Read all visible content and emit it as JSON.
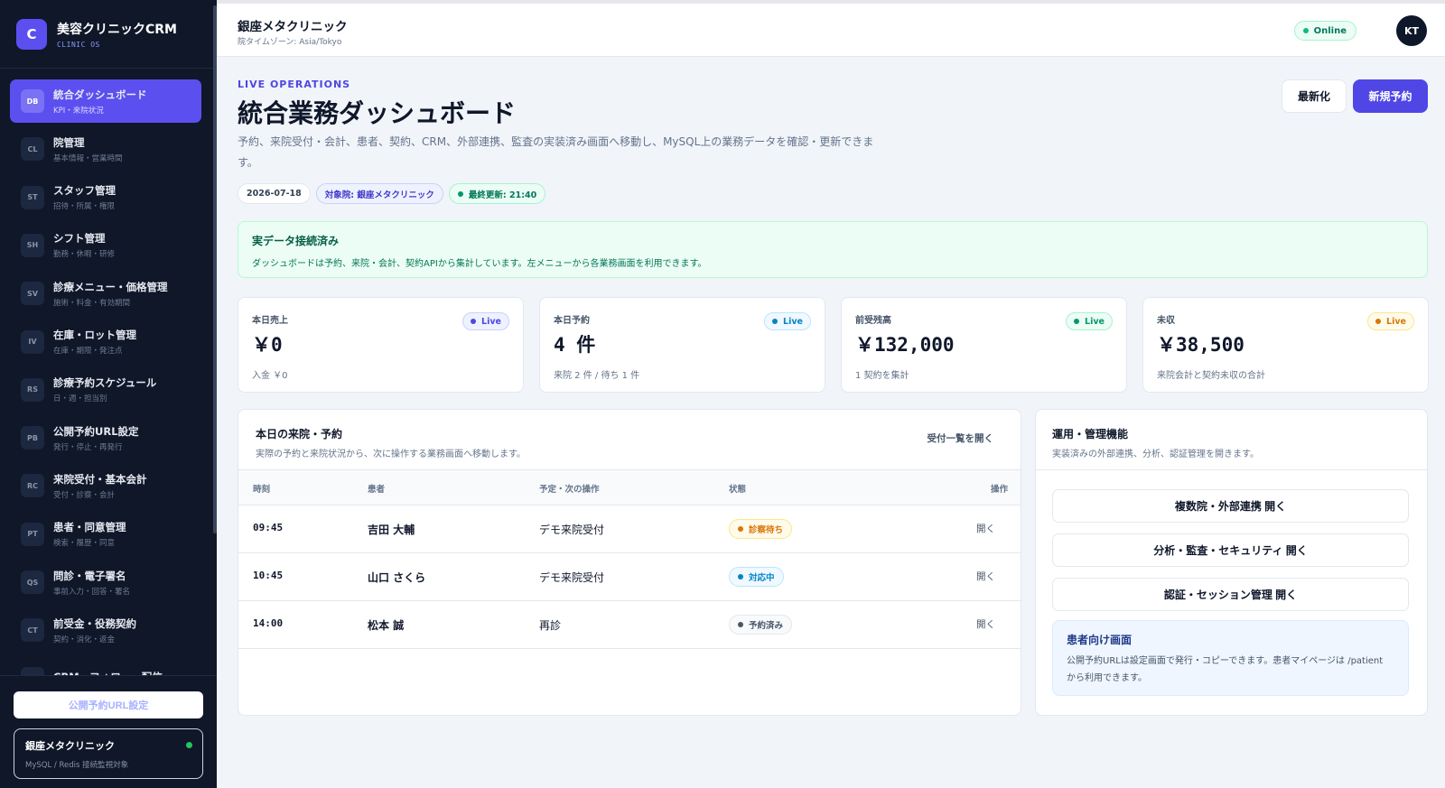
{
  "brand": {
    "logo": "C",
    "title": "美容クリニックCRM",
    "subtitle": "CLINIC OS"
  },
  "sidebar": {
    "items": [
      {
        "code": "DB",
        "label": "統合ダッシュボード",
        "sub": "KPI・来院状況",
        "active": true
      },
      {
        "code": "CL",
        "label": "院管理",
        "sub": "基本情報・営業時間"
      },
      {
        "code": "ST",
        "label": "スタッフ管理",
        "sub": "招待・所属・権限"
      },
      {
        "code": "SH",
        "label": "シフト管理",
        "sub": "勤務・休暇・研修"
      },
      {
        "code": "SV",
        "label": "診療メニュー・価格管理",
        "sub": "施術・料金・有効期間"
      },
      {
        "code": "IV",
        "label": "在庫・ロット管理",
        "sub": "在庫・期限・発注点"
      },
      {
        "code": "RS",
        "label": "診療予約スケジュール",
        "sub": "日・週・担当別"
      },
      {
        "code": "PB",
        "label": "公開予約URL設定",
        "sub": "発行・停止・再発行"
      },
      {
        "code": "RC",
        "label": "来院受付・基本会計",
        "sub": "受付・診察・会計"
      },
      {
        "code": "PT",
        "label": "患者・同意管理",
        "sub": "検索・履歴・同意"
      },
      {
        "code": "QS",
        "label": "問診・電子署名",
        "sub": "事前入力・回答・署名"
      },
      {
        "code": "CT",
        "label": "前受金・役務契約",
        "sub": "契約・消化・返金"
      },
      {
        "code": "CR",
        "label": "CRM・フォロー・配信",
        "sub": ""
      }
    ],
    "public_url_button": "公開予約URL設定",
    "clinic_name": "銀座メタクリニック",
    "clinic_sub": "MySQL / Redis 接続監視対象"
  },
  "header": {
    "clinic_title": "銀座メタクリニック",
    "timezone": "院タイムゾーン: Asia/Tokyo",
    "online": "Online",
    "avatar": "KT"
  },
  "main": {
    "eyebrow": "LIVE OPERATIONS",
    "title": "統合業務ダッシュボード",
    "description": "予約、来院受付・会計、患者、契約、CRM、外部連携、監査の実装済み画面へ移動し、MySQL上の業務データを確認・更新できます。",
    "chips": {
      "date": "2026-07-18",
      "target": "対象院: 銀座メタクリニック",
      "updated": "最終更新: 21:40"
    },
    "refresh_button": "最新化",
    "new_booking_button": "新規予約",
    "notice": {
      "title": "実データ接続済み",
      "text": "ダッシュボードは予約、来院・会計、契約APIから集計しています。左メニューから各業務画面を利用できます。"
    }
  },
  "kpis": [
    {
      "label": "本日売上",
      "value": "￥0",
      "sub": "入金 ￥0",
      "badge": "Live",
      "tone": "indigo"
    },
    {
      "label": "本日予約",
      "value": "4 件",
      "sub": "来院 2 件 / 待ち 1 件",
      "badge": "Live",
      "tone": "sky"
    },
    {
      "label": "前受残高",
      "value": "￥132,000",
      "sub": "1 契約を集計",
      "badge": "Live",
      "tone": "green"
    },
    {
      "label": "未収",
      "value": "￥38,500",
      "sub": "来院会計と契約未収の合計",
      "badge": "Live",
      "tone": "amber"
    }
  ],
  "visits": {
    "title": "本日の来院・予約",
    "subtitle": "実際の予約と来院状況から、次に操作する業務画面へ移動します。",
    "link": "受付一覧を開く",
    "columns": [
      "時刻",
      "患者",
      "予定・次の操作",
      "状態",
      "操作"
    ],
    "rows": [
      {
        "time": "09:45",
        "patient": "吉田 大輔",
        "plan": "デモ来院受付",
        "status": "診察待ち",
        "tone": "amber",
        "action": "開く"
      },
      {
        "time": "10:45",
        "patient": "山口 さくら",
        "plan": "デモ来院受付",
        "status": "対応中",
        "tone": "sky",
        "action": "開く"
      },
      {
        "time": "14:00",
        "patient": "松本 誠",
        "plan": "再診",
        "status": "予約済み",
        "tone": "gray",
        "action": "開く"
      }
    ]
  },
  "operations": {
    "title": "運用・管理機能",
    "subtitle": "実装済みの外部連携、分析、認証管理を開きます。",
    "buttons": [
      "複数院・外部連携 開く",
      "分析・監査・セキュリティ 開く",
      "認証・セッション管理 開く"
    ],
    "patient_box": {
      "title": "患者向け画面",
      "text": "公開予約URLは設定画面で発行・コピーできます。患者マイページは /patient から利用できます。"
    }
  },
  "colors": {
    "accent": "#4f46e5",
    "sidebar_bg": "#0f1729",
    "indigo": "#4f46e5",
    "sky": "#0284c7",
    "green": "#059669",
    "amber": "#d97706",
    "gray": "#475569"
  }
}
